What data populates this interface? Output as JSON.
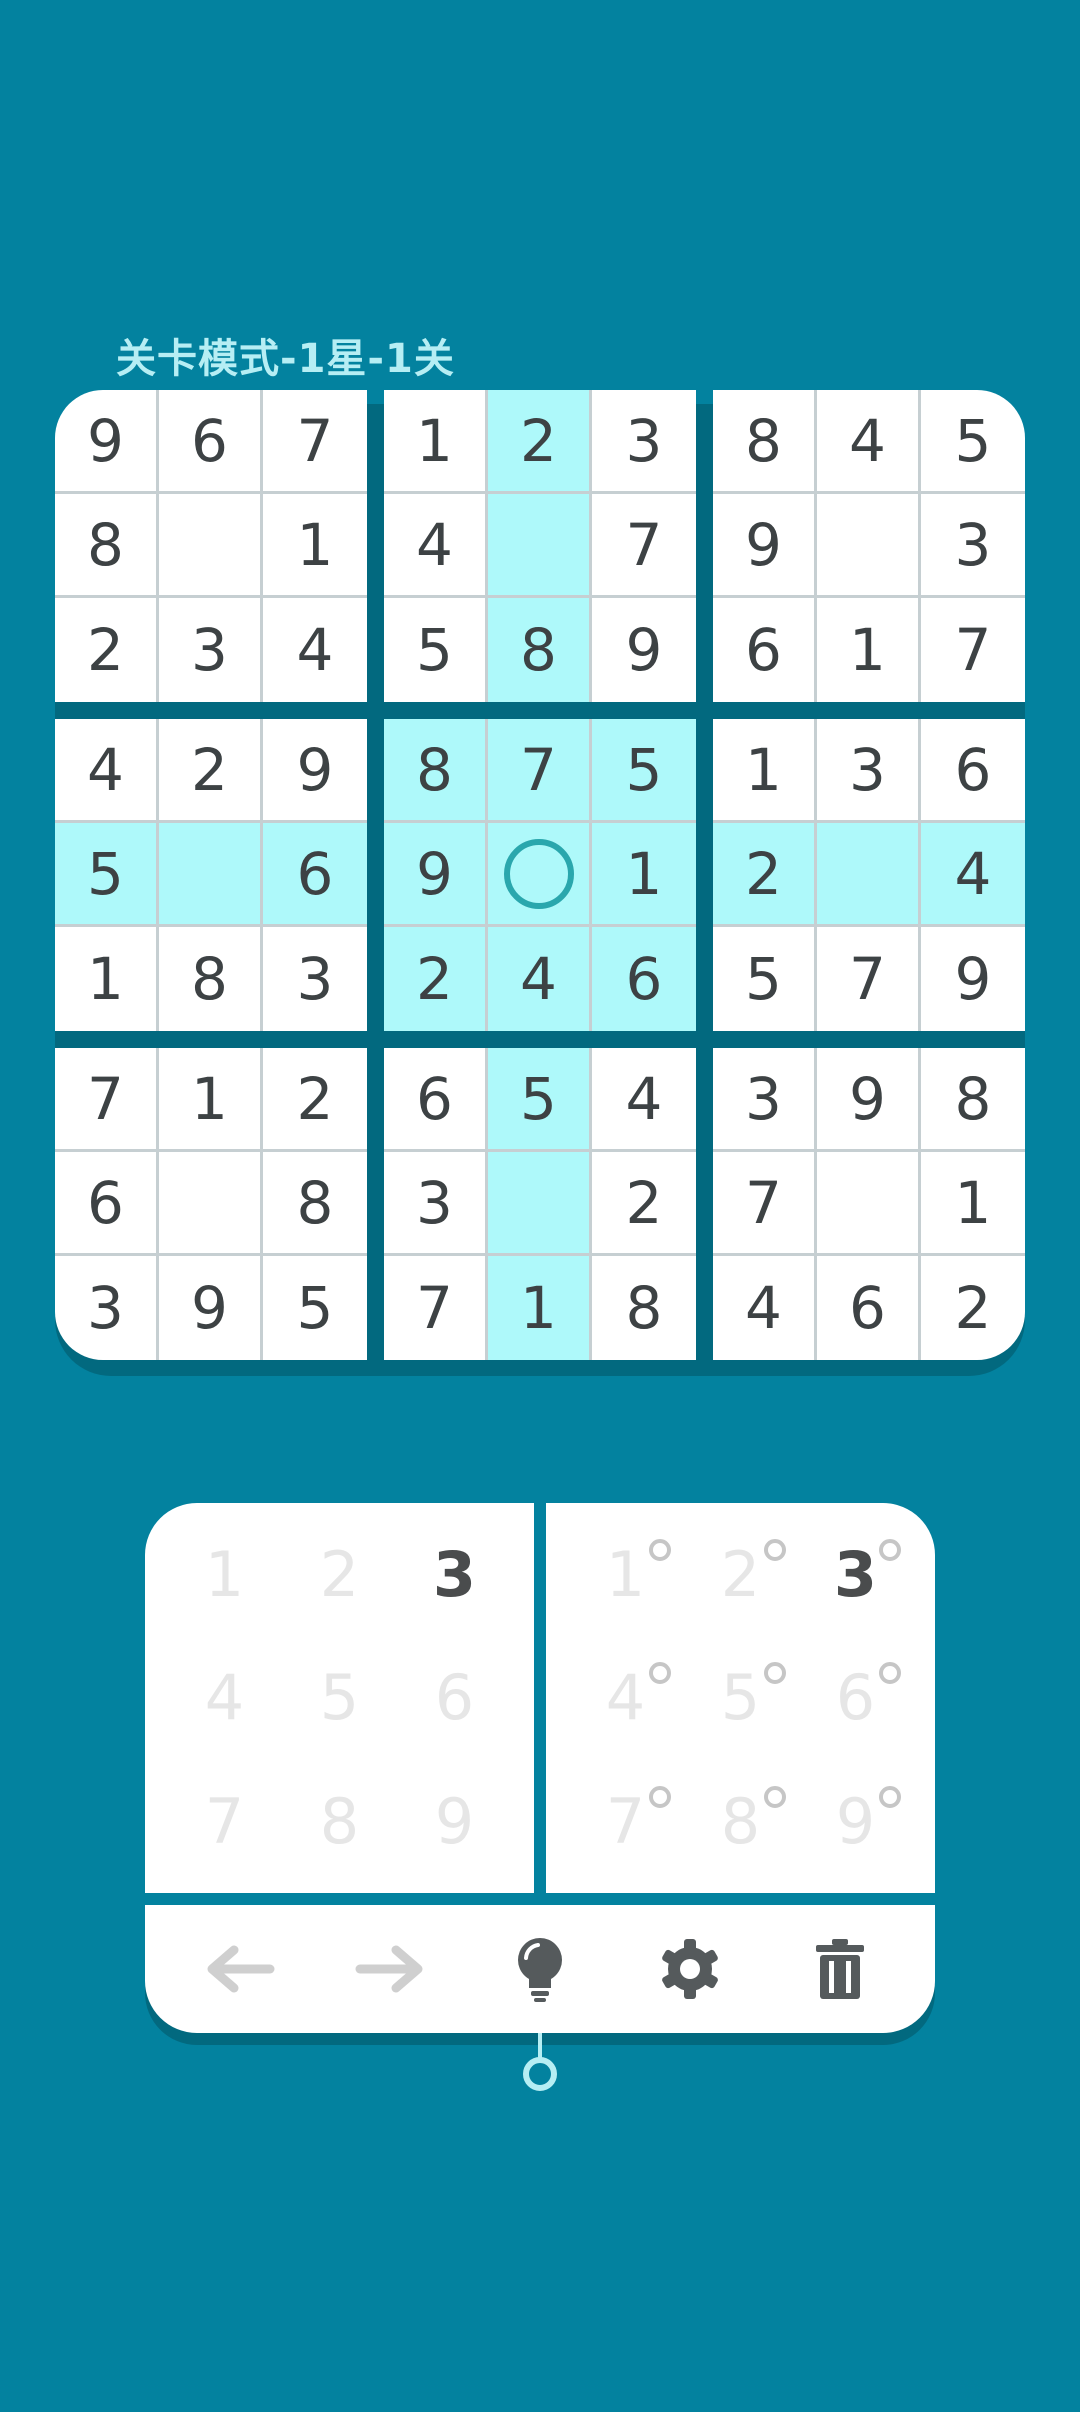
{
  "title": "关卡模式-1星-1关",
  "colors": {
    "background": "#03829f",
    "highlight": "#aef9fa",
    "cell": "#ffffff",
    "digit": "#3d4244",
    "selection_ring": "#2aa7ad"
  },
  "board": {
    "rows": [
      [
        "9",
        "6",
        "7",
        "1",
        "2",
        "3",
        "8",
        "4",
        "5"
      ],
      [
        "8",
        "",
        "1",
        "4",
        "",
        "7",
        "9",
        "",
        "3"
      ],
      [
        "2",
        "3",
        "4",
        "5",
        "8",
        "9",
        "6",
        "1",
        "7"
      ],
      [
        "4",
        "2",
        "9",
        "8",
        "7",
        "5",
        "1",
        "3",
        "6"
      ],
      [
        "5",
        "",
        "6",
        "9",
        "",
        "1",
        "2",
        "",
        "4"
      ],
      [
        "1",
        "8",
        "3",
        "2",
        "4",
        "6",
        "5",
        "7",
        "9"
      ],
      [
        "7",
        "1",
        "2",
        "6",
        "5",
        "4",
        "3",
        "9",
        "8"
      ],
      [
        "6",
        "",
        "8",
        "3",
        "",
        "2",
        "7",
        "",
        "1"
      ],
      [
        "3",
        "9",
        "5",
        "7",
        "1",
        "8",
        "4",
        "6",
        "2"
      ]
    ],
    "selected_row": 4,
    "selected_col": 4
  },
  "keypad": {
    "number_keys": [
      "1",
      "2",
      "3",
      "4",
      "5",
      "6",
      "7",
      "8",
      "9"
    ],
    "note_keys": [
      "1",
      "2",
      "3",
      "4",
      "5",
      "6",
      "7",
      "8",
      "9"
    ],
    "active_key": "3"
  },
  "toolbar": {
    "undo_icon": "arrow-left-icon",
    "redo_icon": "arrow-right-icon",
    "hint_icon": "lightbulb-icon",
    "settings_icon": "gear-icon",
    "erase_icon": "trash-icon"
  }
}
